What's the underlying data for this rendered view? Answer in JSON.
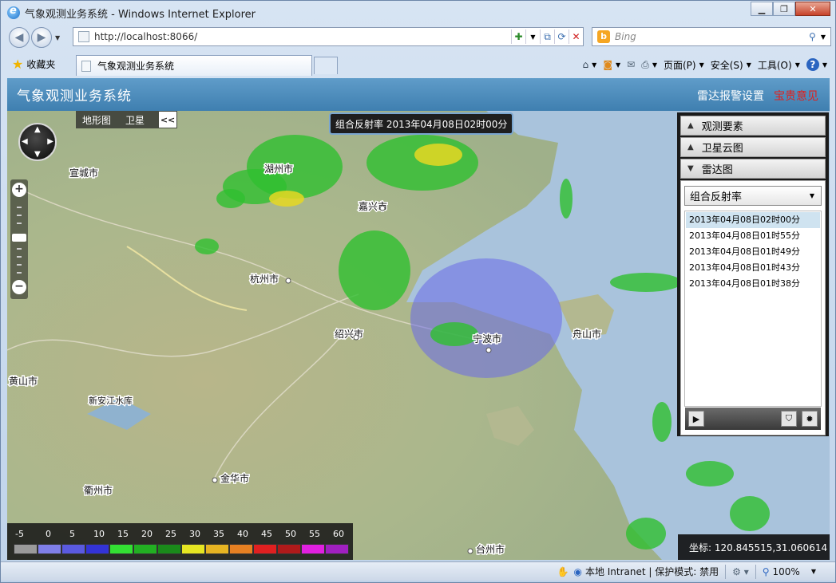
{
  "browser": {
    "window_title": "气象观测业务系统 - Windows Internet Explorer",
    "url": "http://localhost:8066/",
    "search_placeholder": "Bing",
    "favorites_label": "收藏夹",
    "tab_title": "气象观测业务系统",
    "commands": {
      "page": "页面(P)",
      "safety": "安全(S)",
      "tools": "工具(O)"
    },
    "status": {
      "zone": "本地 Intranet | 保护模式: 禁用",
      "zoom": "100%"
    }
  },
  "app": {
    "title": "气象观测业务系统",
    "links": {
      "radar_alarm": "雷达报警设置",
      "feedback": "宝贵意见"
    }
  },
  "map": {
    "type_buttons": [
      "地形图",
      "卫星"
    ],
    "collapse_symbol": "<<",
    "time_badge": "组合反射率 2013年04月08日02时00分",
    "coords": "坐标: 120.845515,31.060614",
    "cities": [
      "湖州市",
      "嘉兴市",
      "宣城市",
      "杭州市",
      "绍兴市",
      "宁波市",
      "舟山市",
      "黄山市",
      "新安江水库",
      "金华市",
      "衢州市",
      "台州市"
    ]
  },
  "legend": {
    "values": [
      "-5",
      "0",
      "5",
      "10",
      "15",
      "20",
      "25",
      "30",
      "35",
      "40",
      "45",
      "50",
      "55",
      "60"
    ],
    "colors": [
      "#9a9a9a",
      "#7f7fe8",
      "#5a5ae0",
      "#3333d6",
      "#33e033",
      "#22b022",
      "#1a8a1a",
      "#e6e622",
      "#e6b422",
      "#e68022",
      "#e02020",
      "#b01a1a",
      "#e020e0",
      "#a020c0"
    ]
  },
  "panel": {
    "sections": [
      "观测要素",
      "卫星云图",
      "雷达图"
    ],
    "product_select": "组合反射率",
    "times": [
      "2013年04月08日02时00分",
      "2013年04月08日01时55分",
      "2013年04月08日01时49分",
      "2013年04月08日01时43分",
      "2013年04月08日01时38分"
    ],
    "selected_index": 0
  }
}
